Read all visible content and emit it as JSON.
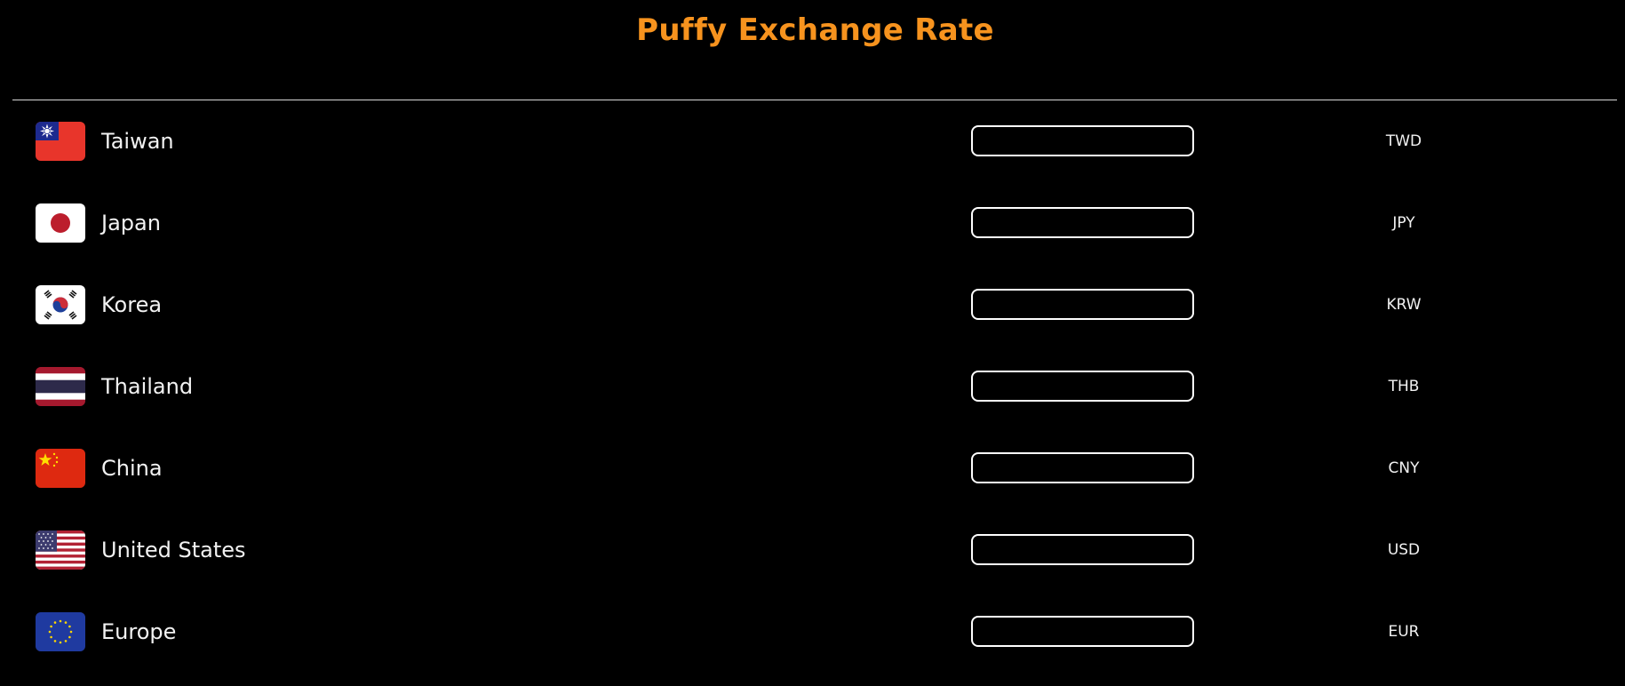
{
  "header": {
    "title": "Puffy Exchange Rate",
    "title_color": "#f7931e"
  },
  "currencies": [
    {
      "country": "Taiwan",
      "code": "TWD",
      "flag_icon": "taiwan-flag-icon",
      "amount": ""
    },
    {
      "country": "Japan",
      "code": "JPY",
      "flag_icon": "japan-flag-icon",
      "amount": ""
    },
    {
      "country": "Korea",
      "code": "KRW",
      "flag_icon": "korea-flag-icon",
      "amount": ""
    },
    {
      "country": "Thailand",
      "code": "THB",
      "flag_icon": "thailand-flag-icon",
      "amount": ""
    },
    {
      "country": "China",
      "code": "CNY",
      "flag_icon": "china-flag-icon",
      "amount": ""
    },
    {
      "country": "United States",
      "code": "USD",
      "flag_icon": "usa-flag-icon",
      "amount": ""
    },
    {
      "country": "Europe",
      "code": "EUR",
      "flag_icon": "eu-flag-icon",
      "amount": ""
    }
  ]
}
